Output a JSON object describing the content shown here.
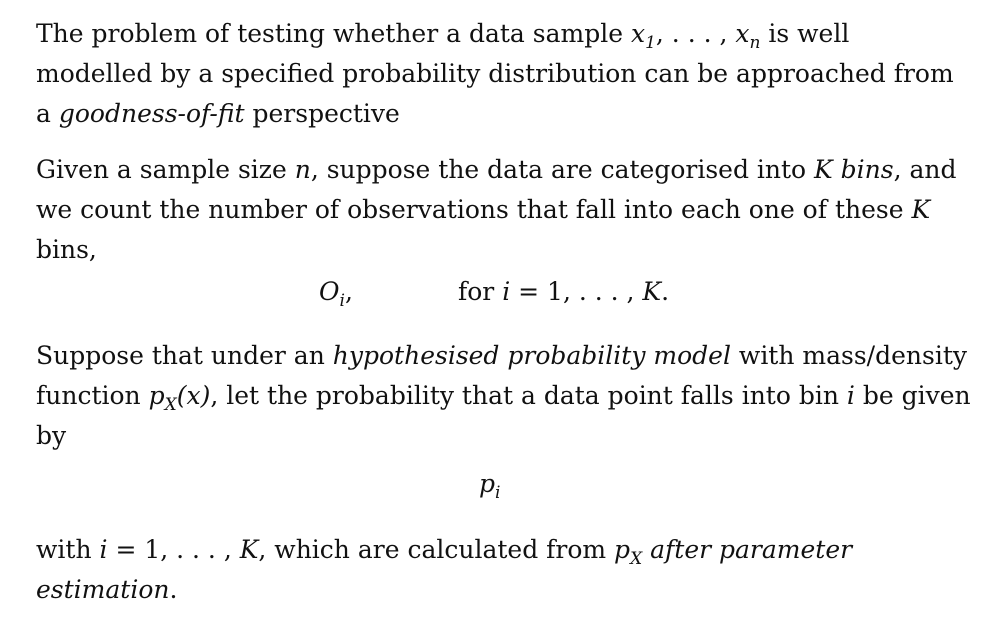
{
  "p1": {
    "t1": "The problem of testing whether a data sample ",
    "x1": "x",
    "x1_sub": "1",
    "comma_dots": ", . . . , ",
    "xn": "x",
    "xn_sub": "n",
    "t2": " is well modelled by a specified probability distribution can be approached from a ",
    "em": "goodness-of-fit",
    "t3": " perspective"
  },
  "p2": {
    "t1": "Given a sample size ",
    "n": "n",
    "t2": ", suppose the data are categorised into ",
    "em": "K bins",
    "t3": ", and we count the number of observations that fall into each one of these ",
    "K": "K",
    "t4": " bins,"
  },
  "eq1": {
    "O": "O",
    "O_sub": "i",
    "O_comma": ",",
    "for": "for ",
    "i": "i",
    "eq": " = 1, . . . , ",
    "K": "K",
    "dot": "."
  },
  "p3": {
    "t1": "Suppose that under an ",
    "em": "hypothesised probability model",
    "t2": " with mass/density function ",
    "p": "p",
    "p_sub": "X",
    "arg": "(x)",
    "t3": ", let the probability that a data point falls into bin ",
    "i": "i",
    "t4": " be given by"
  },
  "eq2": {
    "p": "p",
    "p_sub": "i"
  },
  "p4": {
    "t1": "with ",
    "i": "i",
    "eq": " = 1, . . . , ",
    "K": "K",
    "t2": ", which are calculated from ",
    "p": "p",
    "p_sub": "X",
    "sp": " ",
    "em": "after parameter estimation",
    "end": "."
  }
}
